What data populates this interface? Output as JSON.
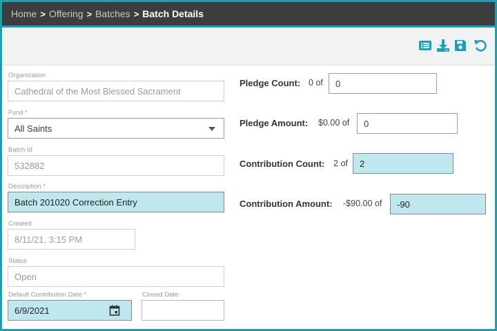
{
  "breadcrumb": {
    "items": [
      "Home",
      "Offering",
      "Batches"
    ],
    "current": "Batch Details",
    "separator": ">"
  },
  "toolbar": {
    "icons": [
      "list-icon",
      "download-icon",
      "save-icon",
      "undo-icon"
    ],
    "color": "#1aa0b6"
  },
  "form": {
    "organization": {
      "label": "Organization",
      "value": "Cathedral of the Most Blessed Sacrament"
    },
    "fund": {
      "label": "Fund *",
      "value": "All Saints"
    },
    "batch_id": {
      "label": "Batch Id",
      "value": "532882"
    },
    "description": {
      "label": "Description *",
      "value": "Batch 201020 Correction Entry"
    },
    "created": {
      "label": "Created",
      "value": "8/11/21, 3:15 PM"
    },
    "status": {
      "label": "Status",
      "value": "Open"
    },
    "default_contribution_date": {
      "label": "Default Contribution Date *",
      "value": "6/9/2021"
    },
    "closed_date": {
      "label": "Closed Date",
      "value": ""
    }
  },
  "totals": {
    "pledge_count": {
      "label": "Pledge Count:",
      "current": "0",
      "of": "of",
      "value": "0"
    },
    "pledge_amount": {
      "label": "Pledge Amount:",
      "current": "$0.00",
      "of": "of",
      "value": "0"
    },
    "contribution_count": {
      "label": "Contribution Count:",
      "current": "2",
      "of": "of",
      "value": "2"
    },
    "contribution_amount": {
      "label": "Contribution Amount:",
      "current": "-$90.00",
      "of": "of",
      "value": "-90"
    }
  },
  "colors": {
    "accent": "#1aa0b6",
    "highlight": "#bfe8ee",
    "header_bg": "#3d3d3d"
  }
}
